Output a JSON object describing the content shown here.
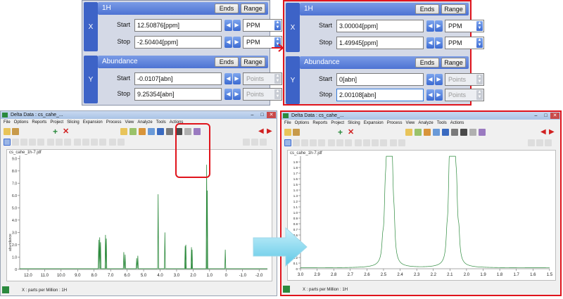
{
  "left_panel": {
    "x_axis": {
      "axis_letter": "X",
      "header": "1H",
      "ends_label": "Ends",
      "range_label": "Range",
      "start_label": "Start",
      "start_value": "12.50876[ppm]",
      "start_unit": "PPM",
      "stop_label": "Stop",
      "stop_value": "-2.50404[ppm]",
      "stop_unit": "PPM"
    },
    "y_axis": {
      "axis_letter": "Y",
      "header": "Abundance",
      "ends_label": "Ends",
      "range_label": "Range",
      "start_label": "Start",
      "start_value": "-0.0107[abn]",
      "start_unit": "Points",
      "stop_label": "Stop",
      "stop_value": "9.25354[abn]",
      "stop_unit": "Points"
    }
  },
  "right_panel": {
    "x_axis": {
      "axis_letter": "X",
      "header": "1H",
      "ends_label": "Ends",
      "range_label": "Range",
      "start_label": "Start",
      "start_value": "3.00004[ppm]",
      "start_unit": "PPM",
      "stop_label": "Stop",
      "stop_value": "1.49945[ppm]",
      "stop_unit": "PPM"
    },
    "y_axis": {
      "axis_letter": "Y",
      "header": "Abundance",
      "ends_label": "Ends",
      "range_label": "Range",
      "start_label": "Start",
      "start_value": "0[abn]",
      "start_unit": "Points",
      "stop_label": "Stop",
      "stop_value": "2.00108[abn]",
      "stop_unit": "Points"
    }
  },
  "left_window": {
    "title": "Delta Data : cs_cahe_...",
    "menu": [
      "File",
      "Options",
      "Reports",
      "Project",
      "Slicing",
      "Expansion",
      "Process",
      "View",
      "Analyze",
      "Tools",
      "Actions"
    ],
    "file_label": "cs_cahe_1h-7.jdf",
    "x_axis_label": "X : parts per Million : 1H",
    "y_axis_label": "abundance",
    "x_ticks": [
      "12.0",
      "11.0",
      "10.0",
      "9.0",
      "8.0",
      "7.0",
      "6.0",
      "5.0",
      "4.0",
      "3.0",
      "2.0",
      "1.0",
      "0",
      "-1.0",
      "-2.0"
    ],
    "y_ticks": [
      "0",
      "1.0",
      "2.0",
      "3.0",
      "4.0",
      "5.0",
      "6.0",
      "7.0",
      "8.0",
      "9.0"
    ]
  },
  "right_window": {
    "title": "Delta Data : cs_cahe_...",
    "menu": [
      "File",
      "Options",
      "Reports",
      "Project",
      "Slicing",
      "Expansion",
      "Process",
      "View",
      "Analyze",
      "Tools",
      "Actions"
    ],
    "file_label": "cs_cahe_1h-7.jdf",
    "x_axis_label": "X : parts per Million : 1H",
    "y_axis_label": "abundance",
    "x_ticks": [
      "3.0",
      "2.9",
      "2.8",
      "2.7",
      "2.6",
      "2.5",
      "2.4",
      "2.3",
      "2.2",
      "2.1",
      "2.0",
      "1.9",
      "1.8",
      "1.7",
      "1.6",
      "1.5"
    ],
    "y_ticks": [
      "0",
      "0.1",
      "0.2",
      "0.3",
      "0.4",
      "0.5",
      "0.6",
      "0.7",
      "0.8",
      "0.9",
      "1.0",
      "1.1",
      "1.2",
      "1.3",
      "1.4",
      "1.5",
      "1.6",
      "1.7",
      "1.8",
      "1.9"
    ]
  },
  "colors": {
    "spectrum": "#2e8b3e",
    "highlight": "#e0141c",
    "arrow_cyan": "#5ec8e6"
  }
}
